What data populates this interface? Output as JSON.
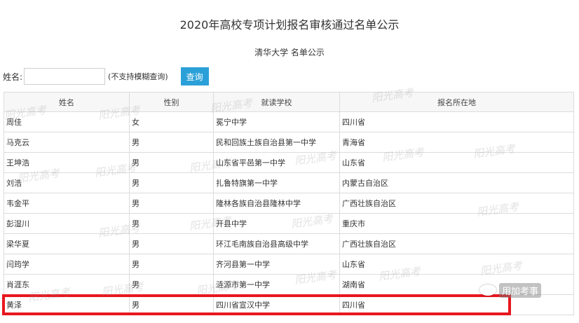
{
  "page": {
    "title": "2020年高校专项计划报名审核通过名单公示",
    "subtitle": "清华大学 名单公示"
  },
  "search": {
    "label": "姓名:",
    "value": "",
    "placeholder": "",
    "hint": "(不支持模糊查询)",
    "button_label": "查询",
    "button_color": "#2ba0d8"
  },
  "table": {
    "headers": [
      "姓名",
      "性别",
      "就读学校",
      "报名所在地"
    ],
    "rows": [
      [
        "周佳",
        "女",
        "冕宁中学",
        "四川省"
      ],
      [
        "马克云",
        "男",
        "民和回族土族自治县第一中学",
        "青海省"
      ],
      [
        "王坤浩",
        "男",
        "山东省平邑第一中学",
        "山东省"
      ],
      [
        "刘浩",
        "男",
        "扎鲁特旗第一中学",
        "内蒙古自治区"
      ],
      [
        "韦金平",
        "男",
        "隆林各族自治县隆林中学",
        "广西壮族自治区"
      ],
      [
        "彭湿川",
        "男",
        "开县中学",
        "重庆市"
      ],
      [
        "梁华夏",
        "男",
        "环江毛南族自治县高级中学",
        "广西壮族自治区"
      ],
      [
        "闫筠学",
        "男",
        "齐河县第一中学",
        "山东省"
      ],
      [
        "肖涯东",
        "男",
        "涟源市第一中学",
        "湖南省"
      ],
      [
        "黄泽",
        "男",
        "四川省宣汉中学",
        "四川省"
      ]
    ],
    "highlighted_row": 9,
    "highlight_color": "#e8171f"
  },
  "watermark_text": "阳光高考",
  "badge_text": "用加考事"
}
